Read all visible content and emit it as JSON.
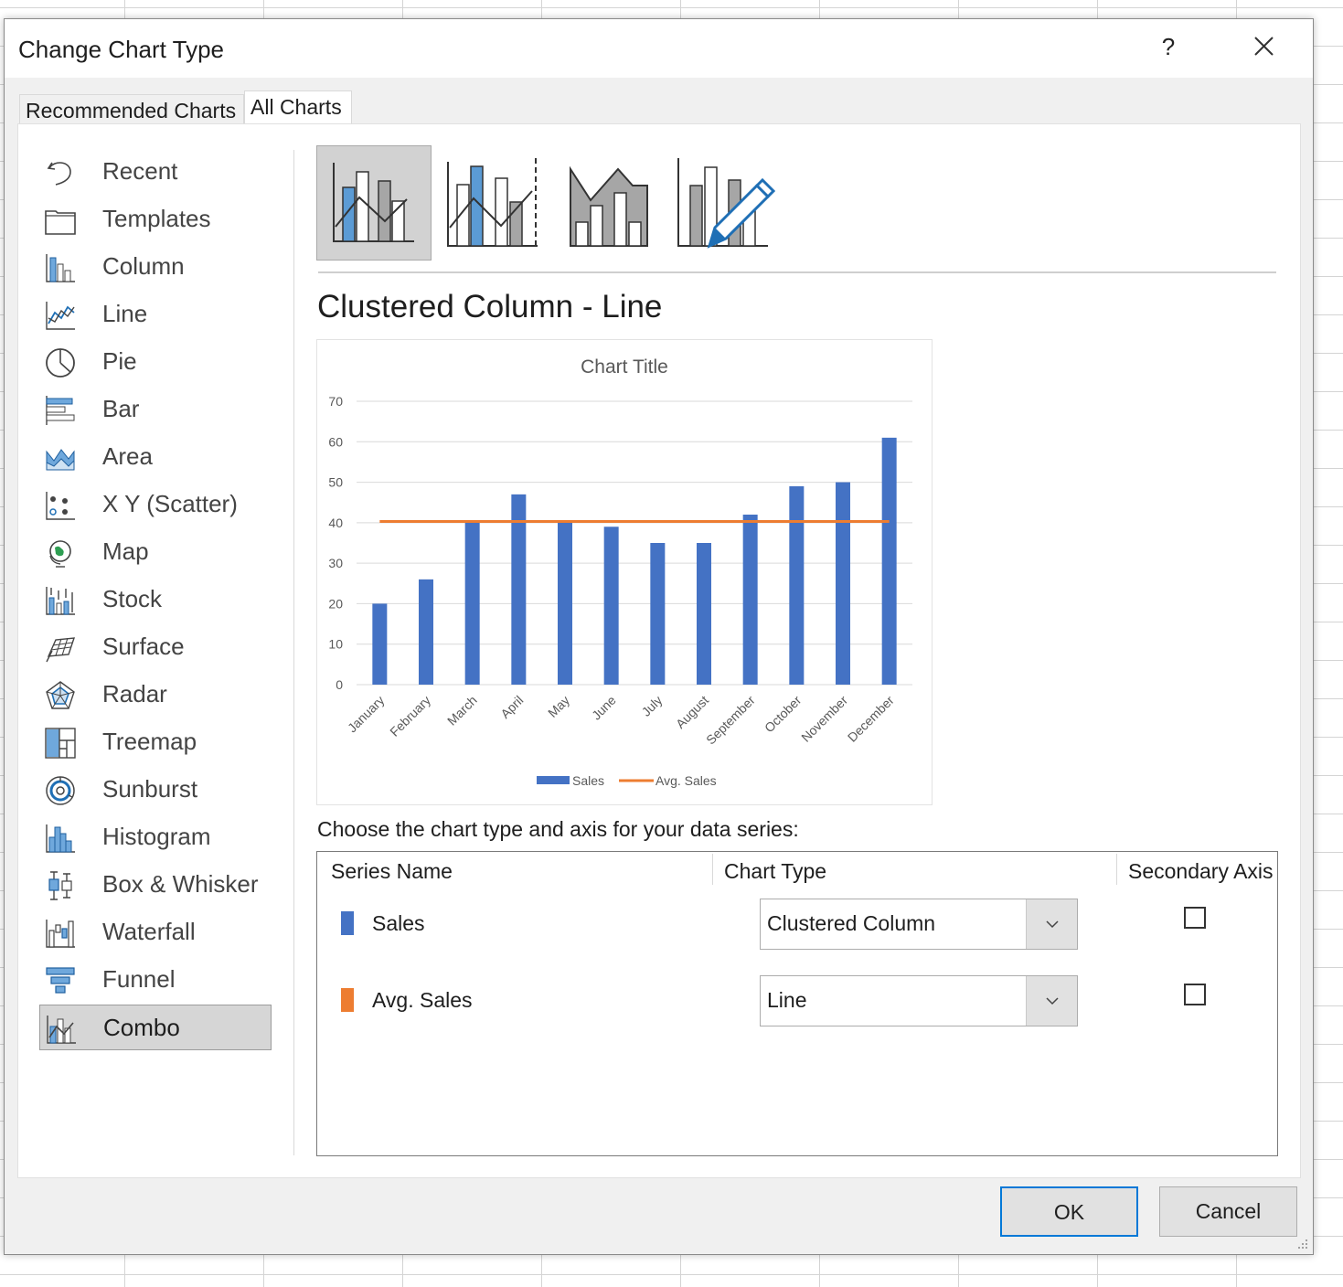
{
  "dialog": {
    "title": "Change Chart Type",
    "help_label": "?",
    "tabs": [
      {
        "label": "Recommended Charts",
        "selected": false
      },
      {
        "label": "All Charts",
        "selected": true
      }
    ]
  },
  "sidebar": {
    "items": [
      {
        "label": "Recent",
        "icon": "recent-icon"
      },
      {
        "label": "Templates",
        "icon": "templates-icon"
      },
      {
        "label": "Column",
        "icon": "column-chart-icon"
      },
      {
        "label": "Line",
        "icon": "line-chart-icon"
      },
      {
        "label": "Pie",
        "icon": "pie-chart-icon"
      },
      {
        "label": "Bar",
        "icon": "bar-chart-icon"
      },
      {
        "label": "Area",
        "icon": "area-chart-icon"
      },
      {
        "label": "X Y (Scatter)",
        "icon": "scatter-chart-icon"
      },
      {
        "label": "Map",
        "icon": "map-chart-icon"
      },
      {
        "label": "Stock",
        "icon": "stock-chart-icon"
      },
      {
        "label": "Surface",
        "icon": "surface-chart-icon"
      },
      {
        "label": "Radar",
        "icon": "radar-chart-icon"
      },
      {
        "label": "Treemap",
        "icon": "treemap-chart-icon"
      },
      {
        "label": "Sunburst",
        "icon": "sunburst-chart-icon"
      },
      {
        "label": "Histogram",
        "icon": "histogram-chart-icon"
      },
      {
        "label": "Box & Whisker",
        "icon": "box-whisker-chart-icon"
      },
      {
        "label": "Waterfall",
        "icon": "waterfall-chart-icon"
      },
      {
        "label": "Funnel",
        "icon": "funnel-chart-icon"
      },
      {
        "label": "Combo",
        "icon": "combo-chart-icon",
        "selected": true
      }
    ]
  },
  "subtypes": {
    "selected_index": 0,
    "items": [
      {
        "icon": "clustered-column-line-icon"
      },
      {
        "icon": "clustered-column-line-secondary-axis-icon"
      },
      {
        "icon": "stacked-area-clustered-column-icon"
      },
      {
        "icon": "custom-combination-icon"
      }
    ],
    "heading": "Clustered Column - Line"
  },
  "chart_data": {
    "type": "bar",
    "title": "Chart Title",
    "categories": [
      "January",
      "February",
      "March",
      "April",
      "May",
      "June",
      "July",
      "August",
      "September",
      "October",
      "November",
      "December"
    ],
    "series": [
      {
        "name": "Sales",
        "type": "bar",
        "color": "#4472c4",
        "values": [
          20,
          26,
          40,
          47,
          40,
          39,
          35,
          35,
          42,
          49,
          50,
          61
        ]
      },
      {
        "name": "Avg. Sales",
        "type": "line",
        "color": "#ed7d31",
        "values": [
          40.3,
          40.3,
          40.3,
          40.3,
          40.3,
          40.3,
          40.3,
          40.3,
          40.3,
          40.3,
          40.3,
          40.3
        ]
      }
    ],
    "ylim": [
      0,
      70
    ],
    "yticks": [
      0,
      10,
      20,
      30,
      40,
      50,
      60,
      70
    ],
    "grid": true,
    "legend": "bottom"
  },
  "series_section": {
    "instructions": "Choose the chart type and axis for your data series:",
    "columns": {
      "name": "Series Name",
      "type": "Chart Type",
      "secondary": "Secondary Axis"
    },
    "rows": [
      {
        "name": "Sales",
        "color": "#4472c4",
        "chart_type": "Clustered Column",
        "secondary_axis": false
      },
      {
        "name": "Avg. Sales",
        "color": "#ed7d31",
        "chart_type": "Line",
        "secondary_axis": false
      }
    ]
  },
  "buttons": {
    "ok": "OK",
    "cancel": "Cancel"
  }
}
